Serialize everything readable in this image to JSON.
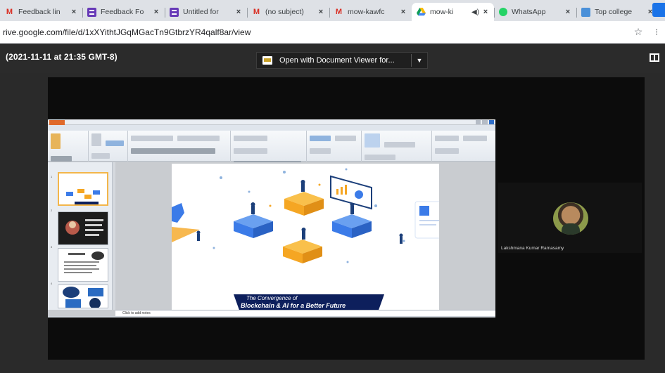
{
  "browser": {
    "tabs": [
      {
        "title": "Feedback lin",
        "favicon": "gmail-icon",
        "active": false
      },
      {
        "title": "Feedback Fo",
        "favicon": "forms-icon",
        "active": false
      },
      {
        "title": "Untitled for",
        "favicon": "forms-icon",
        "active": false
      },
      {
        "title": "(no subject)",
        "favicon": "gmail-icon",
        "active": false
      },
      {
        "title": "mow-kawfc",
        "favicon": "gmail-icon",
        "active": false
      },
      {
        "title": "mow-ki",
        "favicon": "drive-icon",
        "active": true
      },
      {
        "title": "WhatsApp",
        "favicon": "whatsapp-icon",
        "active": false
      },
      {
        "title": "Top college",
        "favicon": "college-icon",
        "active": false
      }
    ],
    "close_glyph": "×",
    "url": "rive.google.com/file/d/1xXYithtJGqMGacTn9GtbrzYR4qalf8ar/view"
  },
  "viewer": {
    "file_title": "(2021-11-11 at 21:35 GMT-8)",
    "open_with_label": "Open with Document Viewer for..."
  },
  "presentation": {
    "notes_placeholder": "Click to add notes",
    "slide_caption_line1": "The Convergence of",
    "slide_caption_line2": "Blockchain & AI for a Better Future",
    "thumbnails": [
      "1",
      "2",
      "3",
      "4"
    ]
  },
  "participant": {
    "name": "Lakshmana Kumar Ramasamy"
  },
  "colors": {
    "drive_bg": "#2a2a2a",
    "stage_bg": "#0c0c0c",
    "accent_orange": "#f5a623",
    "accent_blue": "#3b7be8",
    "banner_navy": "#0d1f5c"
  }
}
